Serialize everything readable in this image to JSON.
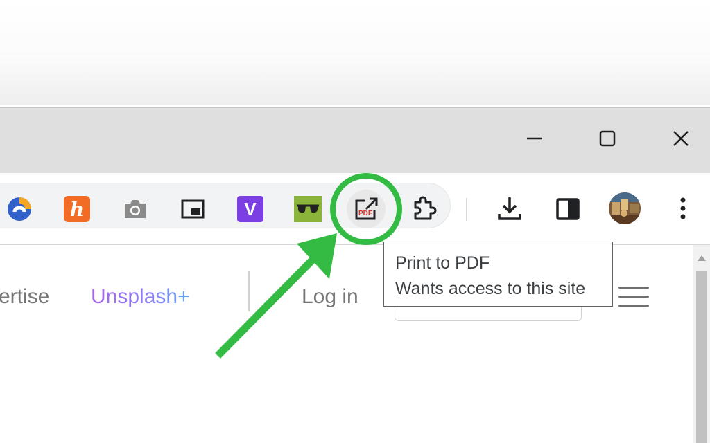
{
  "window": {
    "controls": {
      "minimize": "minimize-icon",
      "maximize": "maximize-icon",
      "close": "close-icon"
    }
  },
  "toolbar": {
    "extensions": [
      {
        "name": "simplenote",
        "icon": "simplenote-icon",
        "color": "#3361cc"
      },
      {
        "name": "honey",
        "icon": "honey-icon",
        "glyph": "h",
        "color": "#f26c25"
      },
      {
        "name": "screenshot",
        "icon": "camera-icon",
        "color": "#8a8a8a"
      },
      {
        "name": "picture-in-picture",
        "icon": "picture-in-picture-icon",
        "color": "#202124"
      },
      {
        "name": "vidiq",
        "icon": "vidiq-icon",
        "glyph": "V",
        "color": "#7b3fe4"
      },
      {
        "name": "glasses",
        "icon": "glasses-icon",
        "color": "#8ab43a"
      },
      {
        "name": "print-to-pdf",
        "icon": "pdf-export-icon",
        "glyph": "PDF",
        "color": "#d32f2f"
      },
      {
        "name": "extensions",
        "icon": "puzzle-icon",
        "color": "#202124"
      }
    ],
    "actions": {
      "download": "download-icon",
      "side_panel": "side-panel-icon",
      "profile": "avatar",
      "menu": "more-vert-icon"
    }
  },
  "page": {
    "nav": {
      "advertise": "ertise",
      "unsplash_plus": "Unsplash+",
      "login": "Log in"
    }
  },
  "tooltip": {
    "title": "Print to PDF",
    "subtitle": "Wants access to this site"
  },
  "annotation": {
    "color": "#33bb44"
  }
}
